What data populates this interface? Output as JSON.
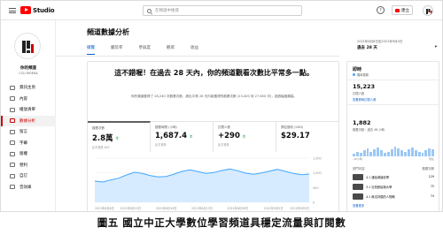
{
  "app": {
    "logo_text": "Studio"
  },
  "search": {
    "placeholder": "在頻道中搜尋"
  },
  "topbar": {
    "create_label": "建立",
    "help": "?"
  },
  "channel": {
    "name": "你的頻道",
    "subtitle": "CCU MOEKA"
  },
  "sidebar": {
    "items": [
      {
        "label": "資訊主頁",
        "icon": "dashboard-icon"
      },
      {
        "label": "內容",
        "icon": "content-icon"
      },
      {
        "label": "播放清單",
        "icon": "playlist-icon"
      },
      {
        "label": "數據分析",
        "icon": "analytics-icon",
        "active": true
      },
      {
        "label": "留言",
        "icon": "comments-icon"
      },
      {
        "label": "字幕",
        "icon": "subtitles-icon"
      },
      {
        "label": "版權",
        "icon": "copyright-icon"
      },
      {
        "label": "營利",
        "icon": "monetization-icon"
      },
      {
        "label": "自訂",
        "icon": "customization-icon"
      },
      {
        "label": "音效庫",
        "icon": "audio-library-icon"
      }
    ]
  },
  "main": {
    "title": "頻道數據分析",
    "tabs": [
      "總覽",
      "觸及率",
      "參與度",
      "觀眾",
      "收益"
    ],
    "date_range": {
      "small": "2021年8月8日至2021年9月5日",
      "label": "過去 28 天"
    },
    "headline": "這不錯喔！在過去 28 天內，你的頻道觀看次數比平常多一點。",
    "summary": "你的頻道獲得了 28,240 次觀看次數，超出平常 28 天內能獲得的觀看次數 (23,400 到 27,600 次)，超過幅度頗高。",
    "metrics": [
      {
        "label": "觀看次數",
        "value": "2.8萬",
        "arrow": "↑",
        "sub": "比平常多 847"
      },
      {
        "label": "觀看時間 (小時)",
        "value": "1,687.4",
        "arrow": "↑",
        "sub": "比平常多"
      },
      {
        "label": "訂閱人數",
        "value": "+290",
        "arrow": "↑",
        "sub": "比平常多"
      },
      {
        "label": "預估營收 (USD)",
        "value": "$29.17",
        "arrow": "",
        "sub": ""
      }
    ]
  },
  "chart_data": {
    "type": "line",
    "x": [
      "2021年8月8日",
      "2021年8月13日",
      "2021年8月18日",
      "2021年8月23日",
      "2021年8月28日",
      "2021年9月2日",
      "2021年9月5日"
    ],
    "series": [
      {
        "values": [
          720,
          690,
          760,
          820,
          930,
          1020,
          980,
          910,
          860,
          880,
          960,
          1050,
          1100,
          1040,
          980,
          1010,
          1080,
          1130,
          1070,
          990,
          950,
          1000,
          1060,
          1120,
          1050,
          980,
          940,
          960
        ]
      }
    ],
    "ylim": [
      0,
      1500
    ],
    "yticks": [
      "0",
      "500",
      "1,000",
      "1,500"
    ],
    "colors": {
      "line": "#3ea6ff",
      "fill": "#d6ebff"
    }
  },
  "right_panel": {
    "title": "即時",
    "live_label": "隨時更新",
    "subscribers": "15,223",
    "subscribers_label": "訂閱人數",
    "subscribers_link": "查看即時訂閱人數",
    "views": "1,882",
    "views_label": "觀看次數・過去 48 小時",
    "axis": [
      "-48小時",
      "現在"
    ],
    "header_left": "熱門內容",
    "header_right": "觀看次數",
    "rows": [
      {
        "title": "4.1 通話導論影帶",
        "value": "129"
      },
      {
        "title": "3.1 社校數據與大學",
        "value": "75"
      },
      {
        "title": "4.1 無法評價的人物概",
        "value": "74"
      }
    ],
    "more_link": "查看更多",
    "bars": [
      0.3,
      0.5,
      0.4,
      0.6,
      0.8,
      0.5,
      0.7,
      0.9,
      0.6,
      0.4,
      0.5,
      0.7,
      1.0,
      0.8,
      0.6,
      0.5,
      0.7,
      0.9,
      0.6,
      0.5,
      0.4,
      0.6,
      0.8,
      0.7
    ]
  },
  "caption": "圖五 國立中正大學數位學習頻道具穩定流量與訂閱數"
}
